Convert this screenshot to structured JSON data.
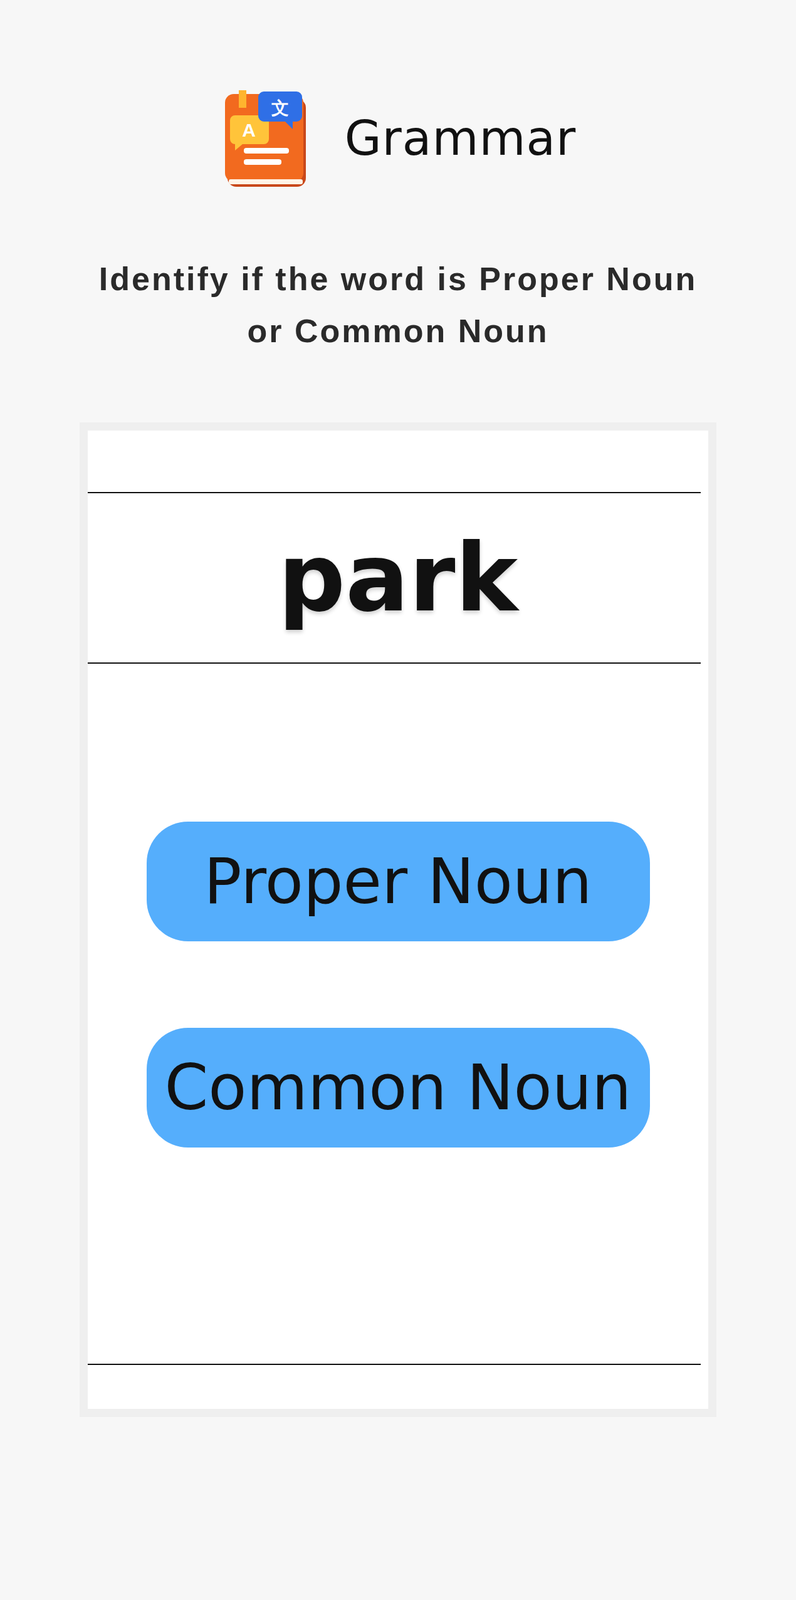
{
  "app": {
    "title": "Grammar",
    "icon_letters": [
      "A",
      "文"
    ]
  },
  "instruction": "Identify if the word is Proper Noun or Common Noun",
  "word": "park",
  "options": [
    {
      "label": "Proper Noun",
      "selected": false
    },
    {
      "label": "Common Noun",
      "selected": false
    }
  ]
}
